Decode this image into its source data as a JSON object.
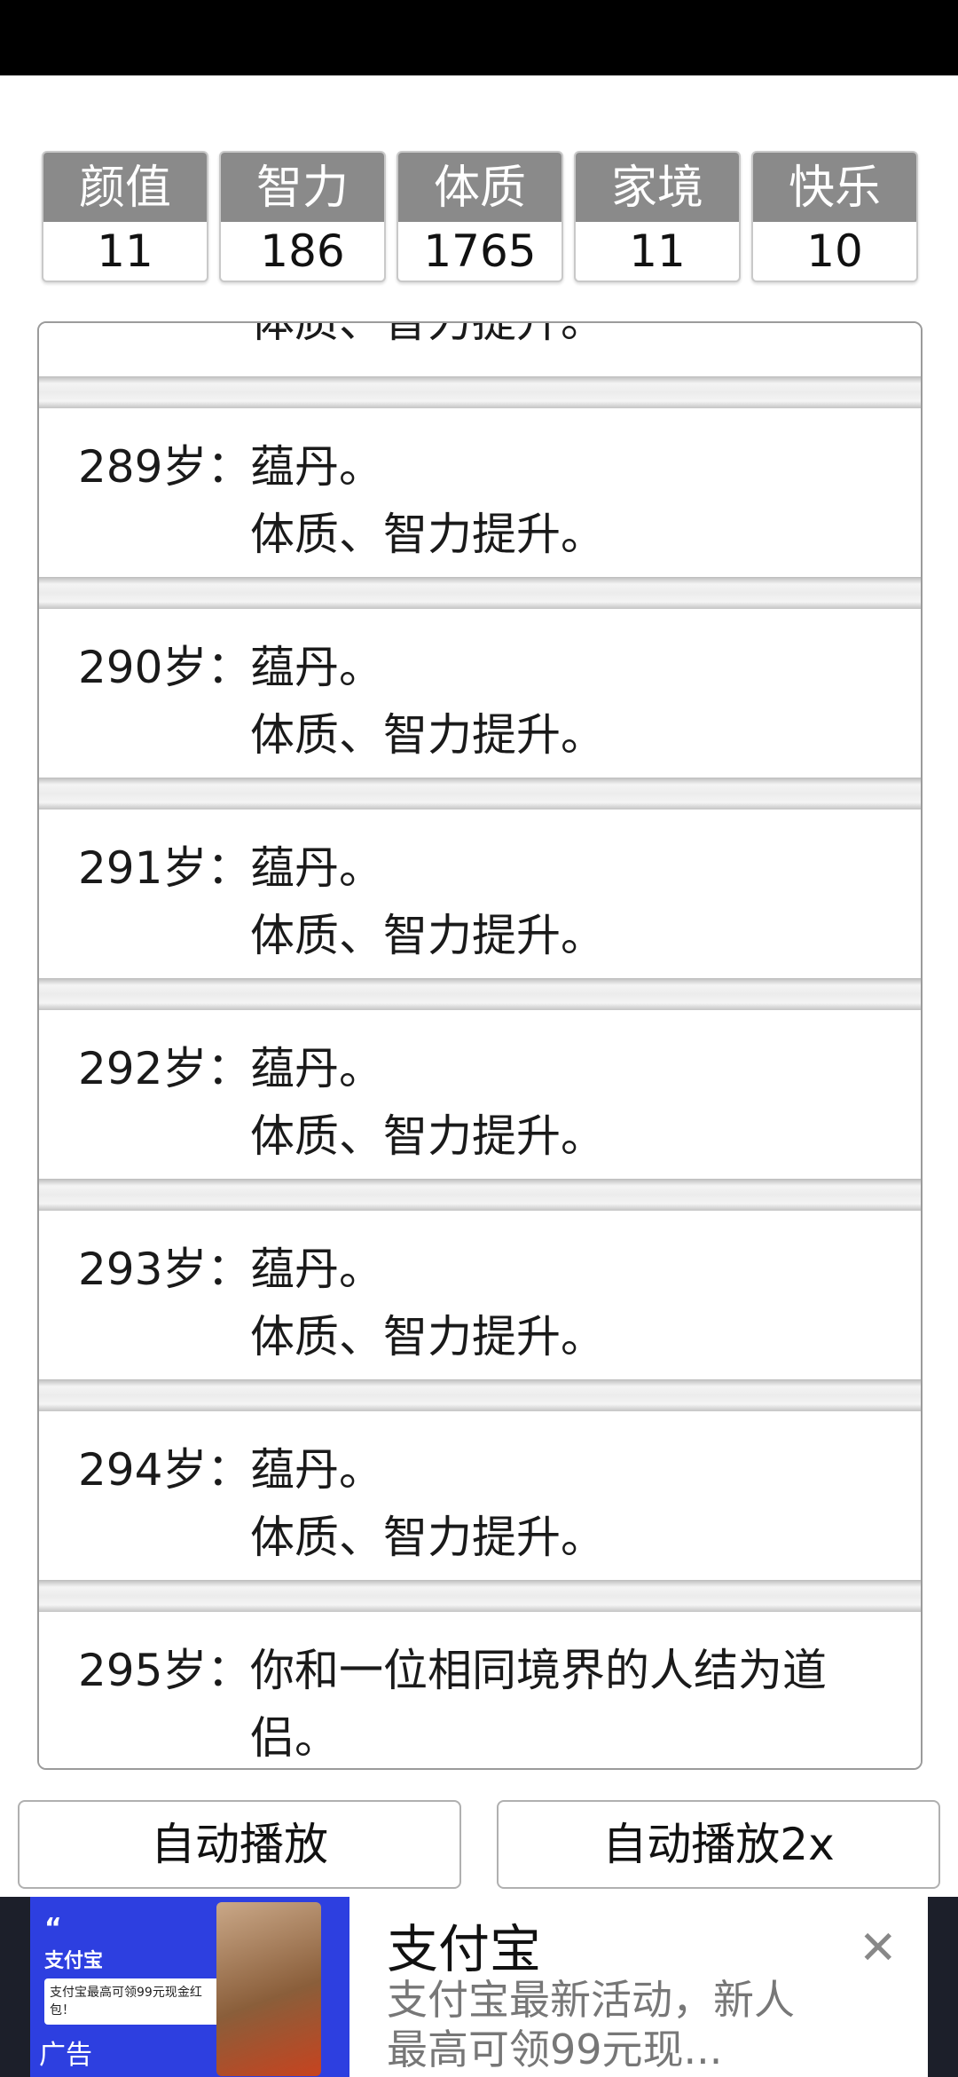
{
  "stats": [
    {
      "name": "颜值",
      "value": "11"
    },
    {
      "name": "智力",
      "value": "186"
    },
    {
      "name": "体质",
      "value": "1765"
    },
    {
      "name": "家境",
      "value": "11"
    },
    {
      "name": "快乐",
      "value": "10"
    }
  ],
  "log": {
    "partial_top_text": "体质、智力提升。",
    "entries": [
      {
        "age": "289岁：",
        "text": "蕴丹。",
        "text2": "体质、智力提升。"
      },
      {
        "age": "290岁：",
        "text": "蕴丹。",
        "text2": "体质、智力提升。"
      },
      {
        "age": "291岁：",
        "text": "蕴丹。",
        "text2": "体质、智力提升。"
      },
      {
        "age": "292岁：",
        "text": "蕴丹。",
        "text2": "体质、智力提升。"
      },
      {
        "age": "293岁：",
        "text": "蕴丹。",
        "text2": "体质、智力提升。"
      },
      {
        "age": "294岁：",
        "text": "蕴丹。",
        "text2": "体质、智力提升。"
      },
      {
        "age": "295岁：",
        "text": "你和一位相同境界的人结为道侣。",
        "text2": ""
      }
    ]
  },
  "buttons": {
    "autoplay": "自动播放",
    "autoplay2x": "自动播放2x"
  },
  "ad": {
    "thumb_brand": "支付宝",
    "thumb_card": "支付宝最高可领99元现金红包！",
    "thumb_label": "广告",
    "title": "支付宝",
    "description": "支付宝最新活动，新人最高可领99元现...",
    "close_icon": "close-icon"
  }
}
